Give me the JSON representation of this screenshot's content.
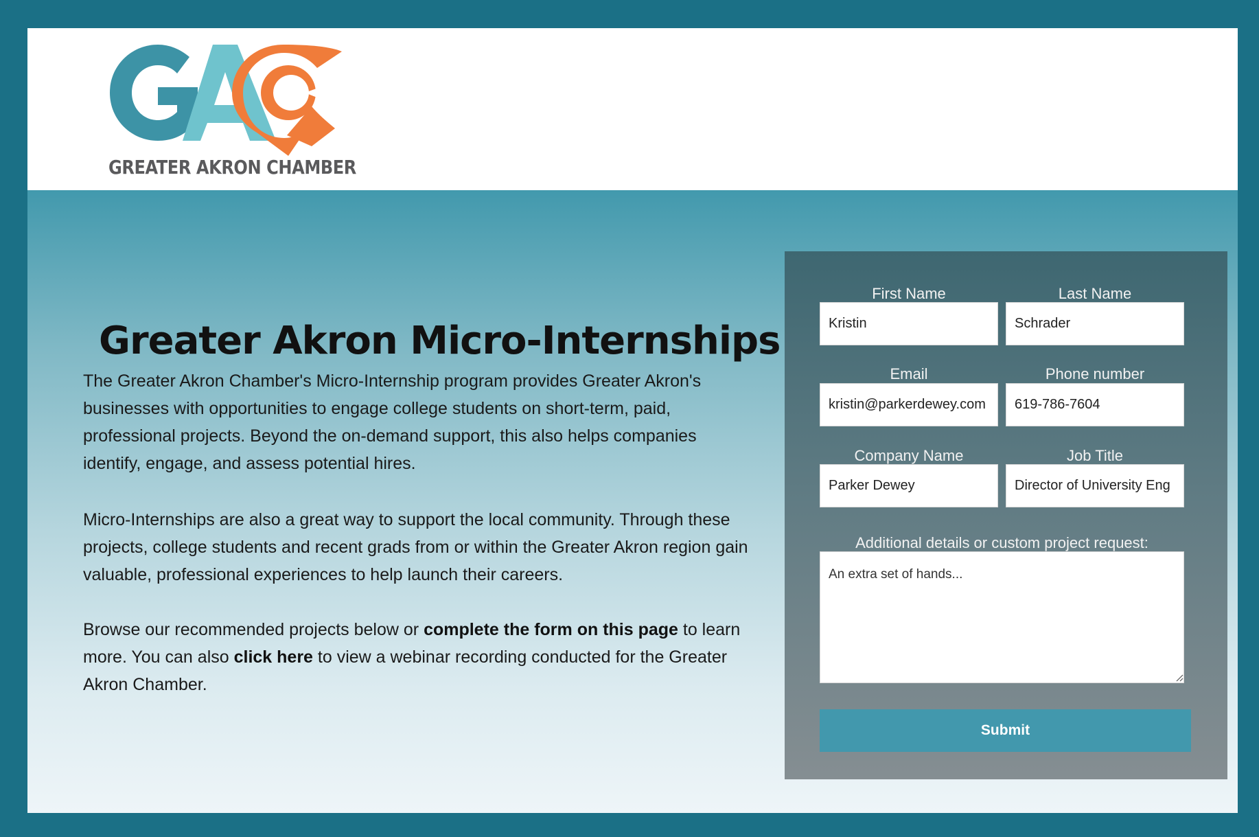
{
  "header": {
    "logo_caption": "GREATER AKRON CHAMBER",
    "logo_letters": "GAC"
  },
  "colors": {
    "border": "#1b7086",
    "teal_dark": "#3d93a6",
    "teal_light": "#6fc3cd",
    "orange": "#f07c3a",
    "button": "#4298ad"
  },
  "hero": {
    "title": "Greater Akron Micro-Internships",
    "p1": "The Greater Akron Chamber's Micro-Internship program provides Greater Akron's businesses with opportunities to engage college students on short-term, paid, professional projects.  Beyond the on-demand support, this also helps companies identify, engage, and assess potential hires.",
    "p2": "Micro-Internships are also a great way to support the local community. Through these projects, college students and recent grads from or within the Greater Akron region gain valuable, professional experiences to help launch their careers.",
    "p3_a": "Browse our recommended projects below or ",
    "p3_bold1": "complete the form on this page",
    "p3_b": " to learn more.  You can also ",
    "p3_bold2": "click here",
    "p3_c": " to view a webinar recording conducted for the Greater Akron Chamber."
  },
  "form": {
    "first_name_label": "First Name",
    "first_name_value": "Kristin",
    "last_name_label": "Last Name",
    "last_name_value": "Schrader",
    "email_label": "Email",
    "email_value": "kristin@parkerdewey.com",
    "phone_label": "Phone number",
    "phone_value": "619-786-7604",
    "company_label": "Company Name",
    "company_value": "Parker Dewey",
    "job_title_label": "Job Title",
    "job_title_value": "Director of University Eng",
    "details_label": "Additional details or custom project request:",
    "details_value": "An extra set of hands...",
    "submit_label": "Submit"
  }
}
